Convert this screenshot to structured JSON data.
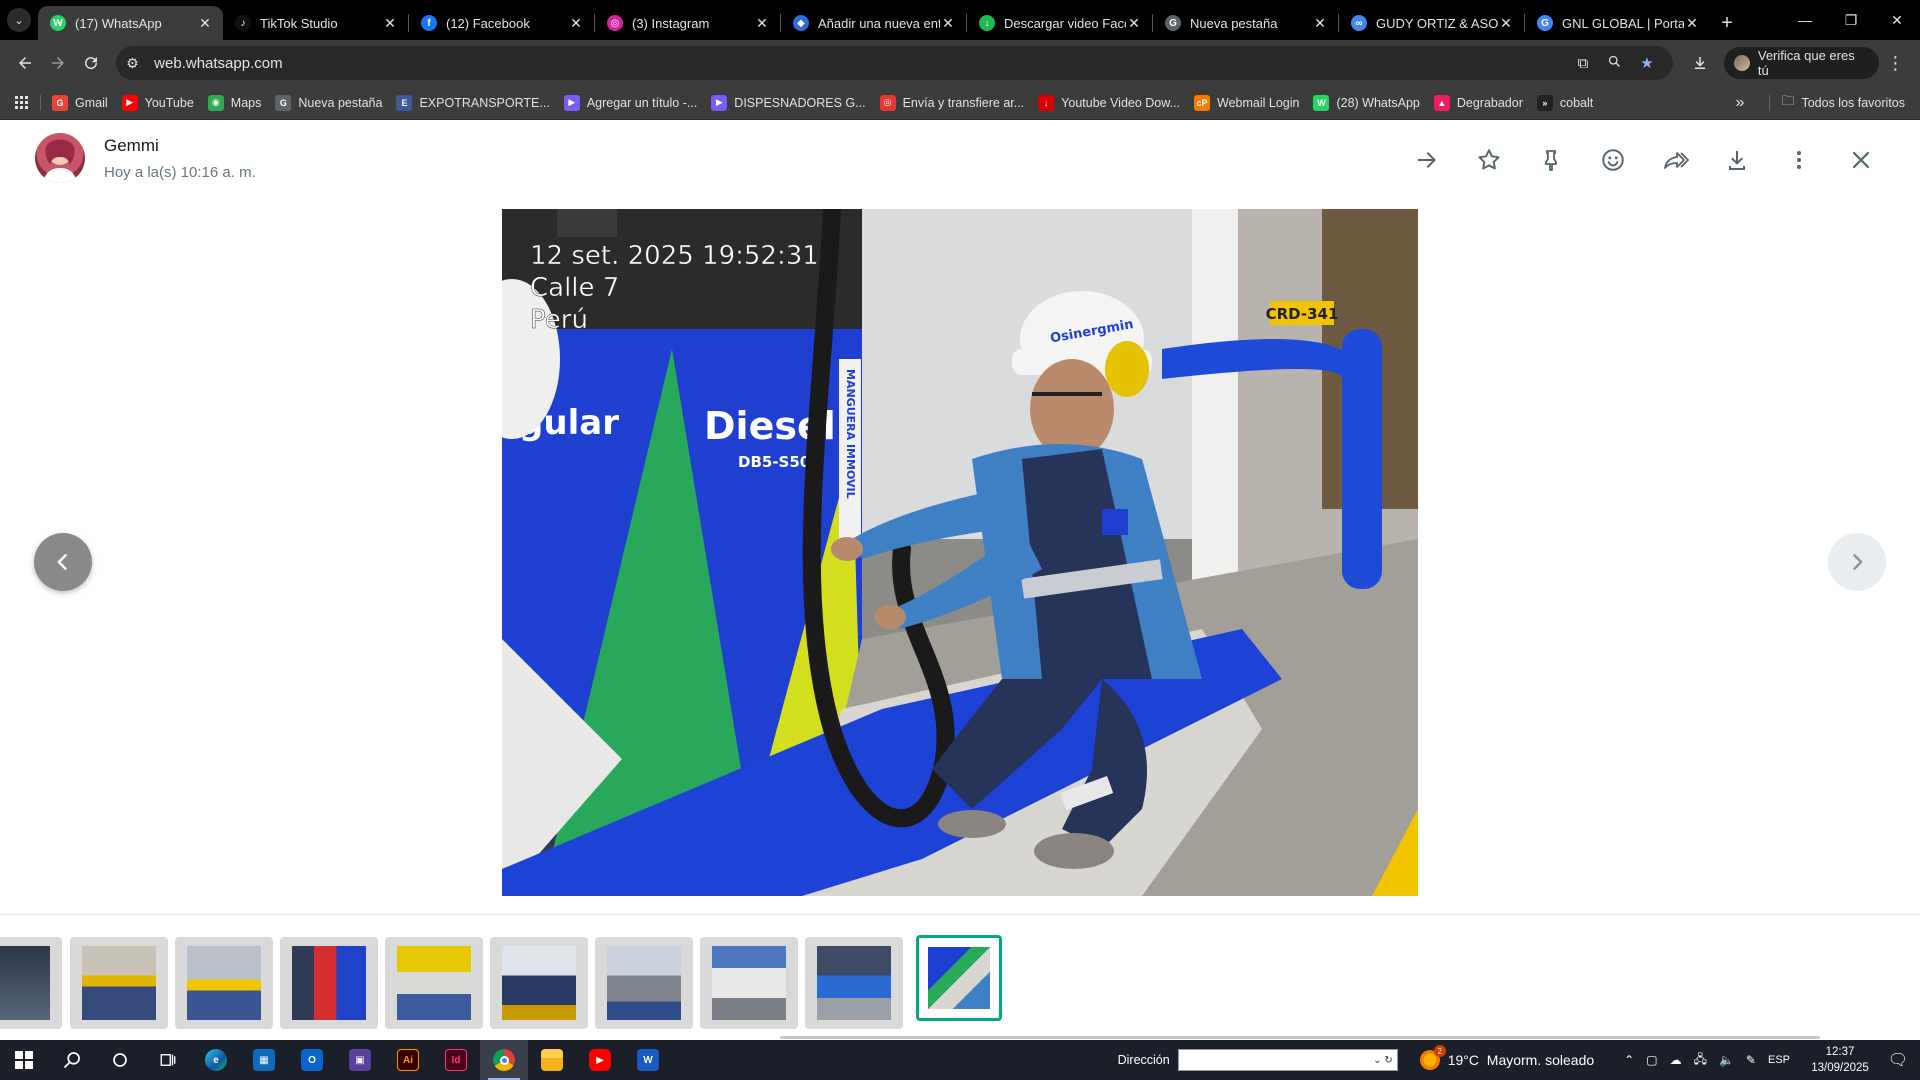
{
  "browser": {
    "tabs": [
      {
        "title": "(17) WhatsApp",
        "color": "#25d366",
        "glyph": "W",
        "active": true
      },
      {
        "title": "TikTok Studio",
        "color": "#111111",
        "glyph": "♪",
        "active": false
      },
      {
        "title": "(12) Facebook",
        "color": "#1877f2",
        "glyph": "f",
        "active": false
      },
      {
        "title": "(3) Instagram",
        "color": "#d6249f",
        "glyph": "◎",
        "active": false
      },
      {
        "title": "Añadir una nueva ent",
        "color": "#2d6cdf",
        "glyph": "◆",
        "active": false
      },
      {
        "title": "Descargar video Face",
        "color": "#1db954",
        "glyph": "↓",
        "active": false
      },
      {
        "title": "Nueva pestaña",
        "color": "#5f6368",
        "glyph": "G",
        "active": false
      },
      {
        "title": "GUDY ORTIZ & ASOC",
        "color": "#4285f4",
        "glyph": "∞",
        "active": false
      },
      {
        "title": "GNL GLOBAL | Portal",
        "color": "#4285f4",
        "glyph": "G",
        "active": false
      }
    ],
    "new_tab": "+",
    "window": {
      "minimize": "—",
      "restore": "❐",
      "close": "✕"
    },
    "url": "web.whatsapp.com",
    "profile_button": "Verifica que eres tú",
    "bookmarks": [
      {
        "label": "Gmail",
        "color": "#ea4335",
        "glyph": "G"
      },
      {
        "label": "YouTube",
        "color": "#ff0000",
        "glyph": "▶"
      },
      {
        "label": "Maps",
        "color": "#34a853",
        "glyph": "◉"
      },
      {
        "label": "Nueva pestaña",
        "color": "#5f6368",
        "glyph": "G"
      },
      {
        "label": "EXPOTRANSPORTE...",
        "color": "#3b5998",
        "glyph": "E"
      },
      {
        "label": "Agregar un título -...",
        "color": "#7b5cf5",
        "glyph": "▶"
      },
      {
        "label": "DISPESNADORES G...",
        "color": "#7b5cf5",
        "glyph": "▶"
      },
      {
        "label": "Envía y transfiere ar...",
        "color": "#e53935",
        "glyph": "◎"
      },
      {
        "label": "Youtube Video Dow...",
        "color": "#d50000",
        "glyph": "↓"
      },
      {
        "label": "Webmail Login",
        "color": "#f57c00",
        "glyph": "cP"
      },
      {
        "label": "(28) WhatsApp",
        "color": "#25d366",
        "glyph": "W"
      },
      {
        "label": "Degrabador",
        "color": "#e91e63",
        "glyph": "▲"
      },
      {
        "label": "cobalt",
        "color": "#222222",
        "glyph": "»"
      }
    ],
    "more_bookmarks": "»",
    "all_bookmarks": "Todos los favoritos"
  },
  "viewer": {
    "sender": "Gemmi",
    "time": "Hoy a la(s) 10:16 a. m.",
    "actions": [
      "arrow-right-icon",
      "star-icon",
      "pin-icon",
      "emoji-icon",
      "forward-icon",
      "download-icon",
      "more-icon",
      "close-icon"
    ],
    "photo_overlay": {
      "line1": "12 set. 2025 19:52:31",
      "line2": "Calle 7",
      "line3": "Perú"
    },
    "photo_text": {
      "pump_left": "egular",
      "pump_diesel": "Diesel",
      "pump_grade": "DB5-S50",
      "plate": "CRD-341",
      "hose_tag": "MANGUERA IMMOVIL",
      "helmet": "Osinergmin"
    },
    "thumbnail_count": 10,
    "selected_thumbnail": 10
  },
  "taskbar": {
    "address_label": "Dirección",
    "weather": "19°C  Mayorm. soleado",
    "weather_badge": "2",
    "language": "ESP",
    "time": "12:37",
    "date": "13/09/2025"
  }
}
